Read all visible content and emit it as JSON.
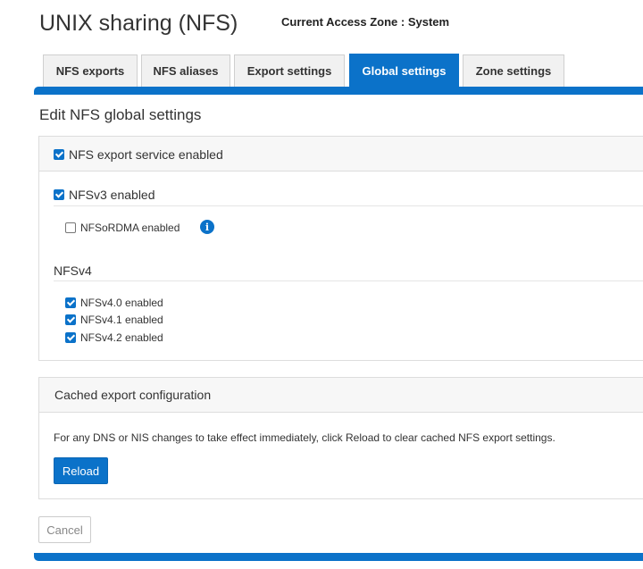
{
  "header": {
    "title": "UNIX sharing (NFS)",
    "access_zone": "Current Access Zone : System"
  },
  "tabs": [
    {
      "label": "NFS exports",
      "active": false
    },
    {
      "label": "NFS aliases",
      "active": false
    },
    {
      "label": "Export settings",
      "active": false
    },
    {
      "label": "Global settings",
      "active": true
    },
    {
      "label": "Zone settings",
      "active": false
    }
  ],
  "page_heading": "Edit NFS global settings",
  "service_panel": {
    "service_enabled": {
      "label": "NFS export service enabled",
      "checked": true
    },
    "nfsv3": {
      "label": "NFSv3 enabled",
      "checked": true
    },
    "nfsordma": {
      "label": "NFSoRDMA enabled",
      "checked": false
    },
    "nfsv4_heading": "NFSv4",
    "nfsv4_options": [
      {
        "label": "NFSv4.0 enabled",
        "checked": true
      },
      {
        "label": "NFSv4.1 enabled",
        "checked": true
      },
      {
        "label": "NFSv4.2 enabled",
        "checked": true
      }
    ]
  },
  "cache_panel": {
    "heading": "Cached export configuration",
    "description": "For any DNS or NIS changes to take effect immediately, click Reload to clear cached NFS export settings.",
    "reload_label": "Reload"
  },
  "footer": {
    "cancel_label": "Cancel"
  },
  "icons": {
    "info": "info-icon"
  },
  "colors": {
    "accent": "#0b72c9",
    "panel_header": "#f7f7f7",
    "border": "#dddddd"
  }
}
